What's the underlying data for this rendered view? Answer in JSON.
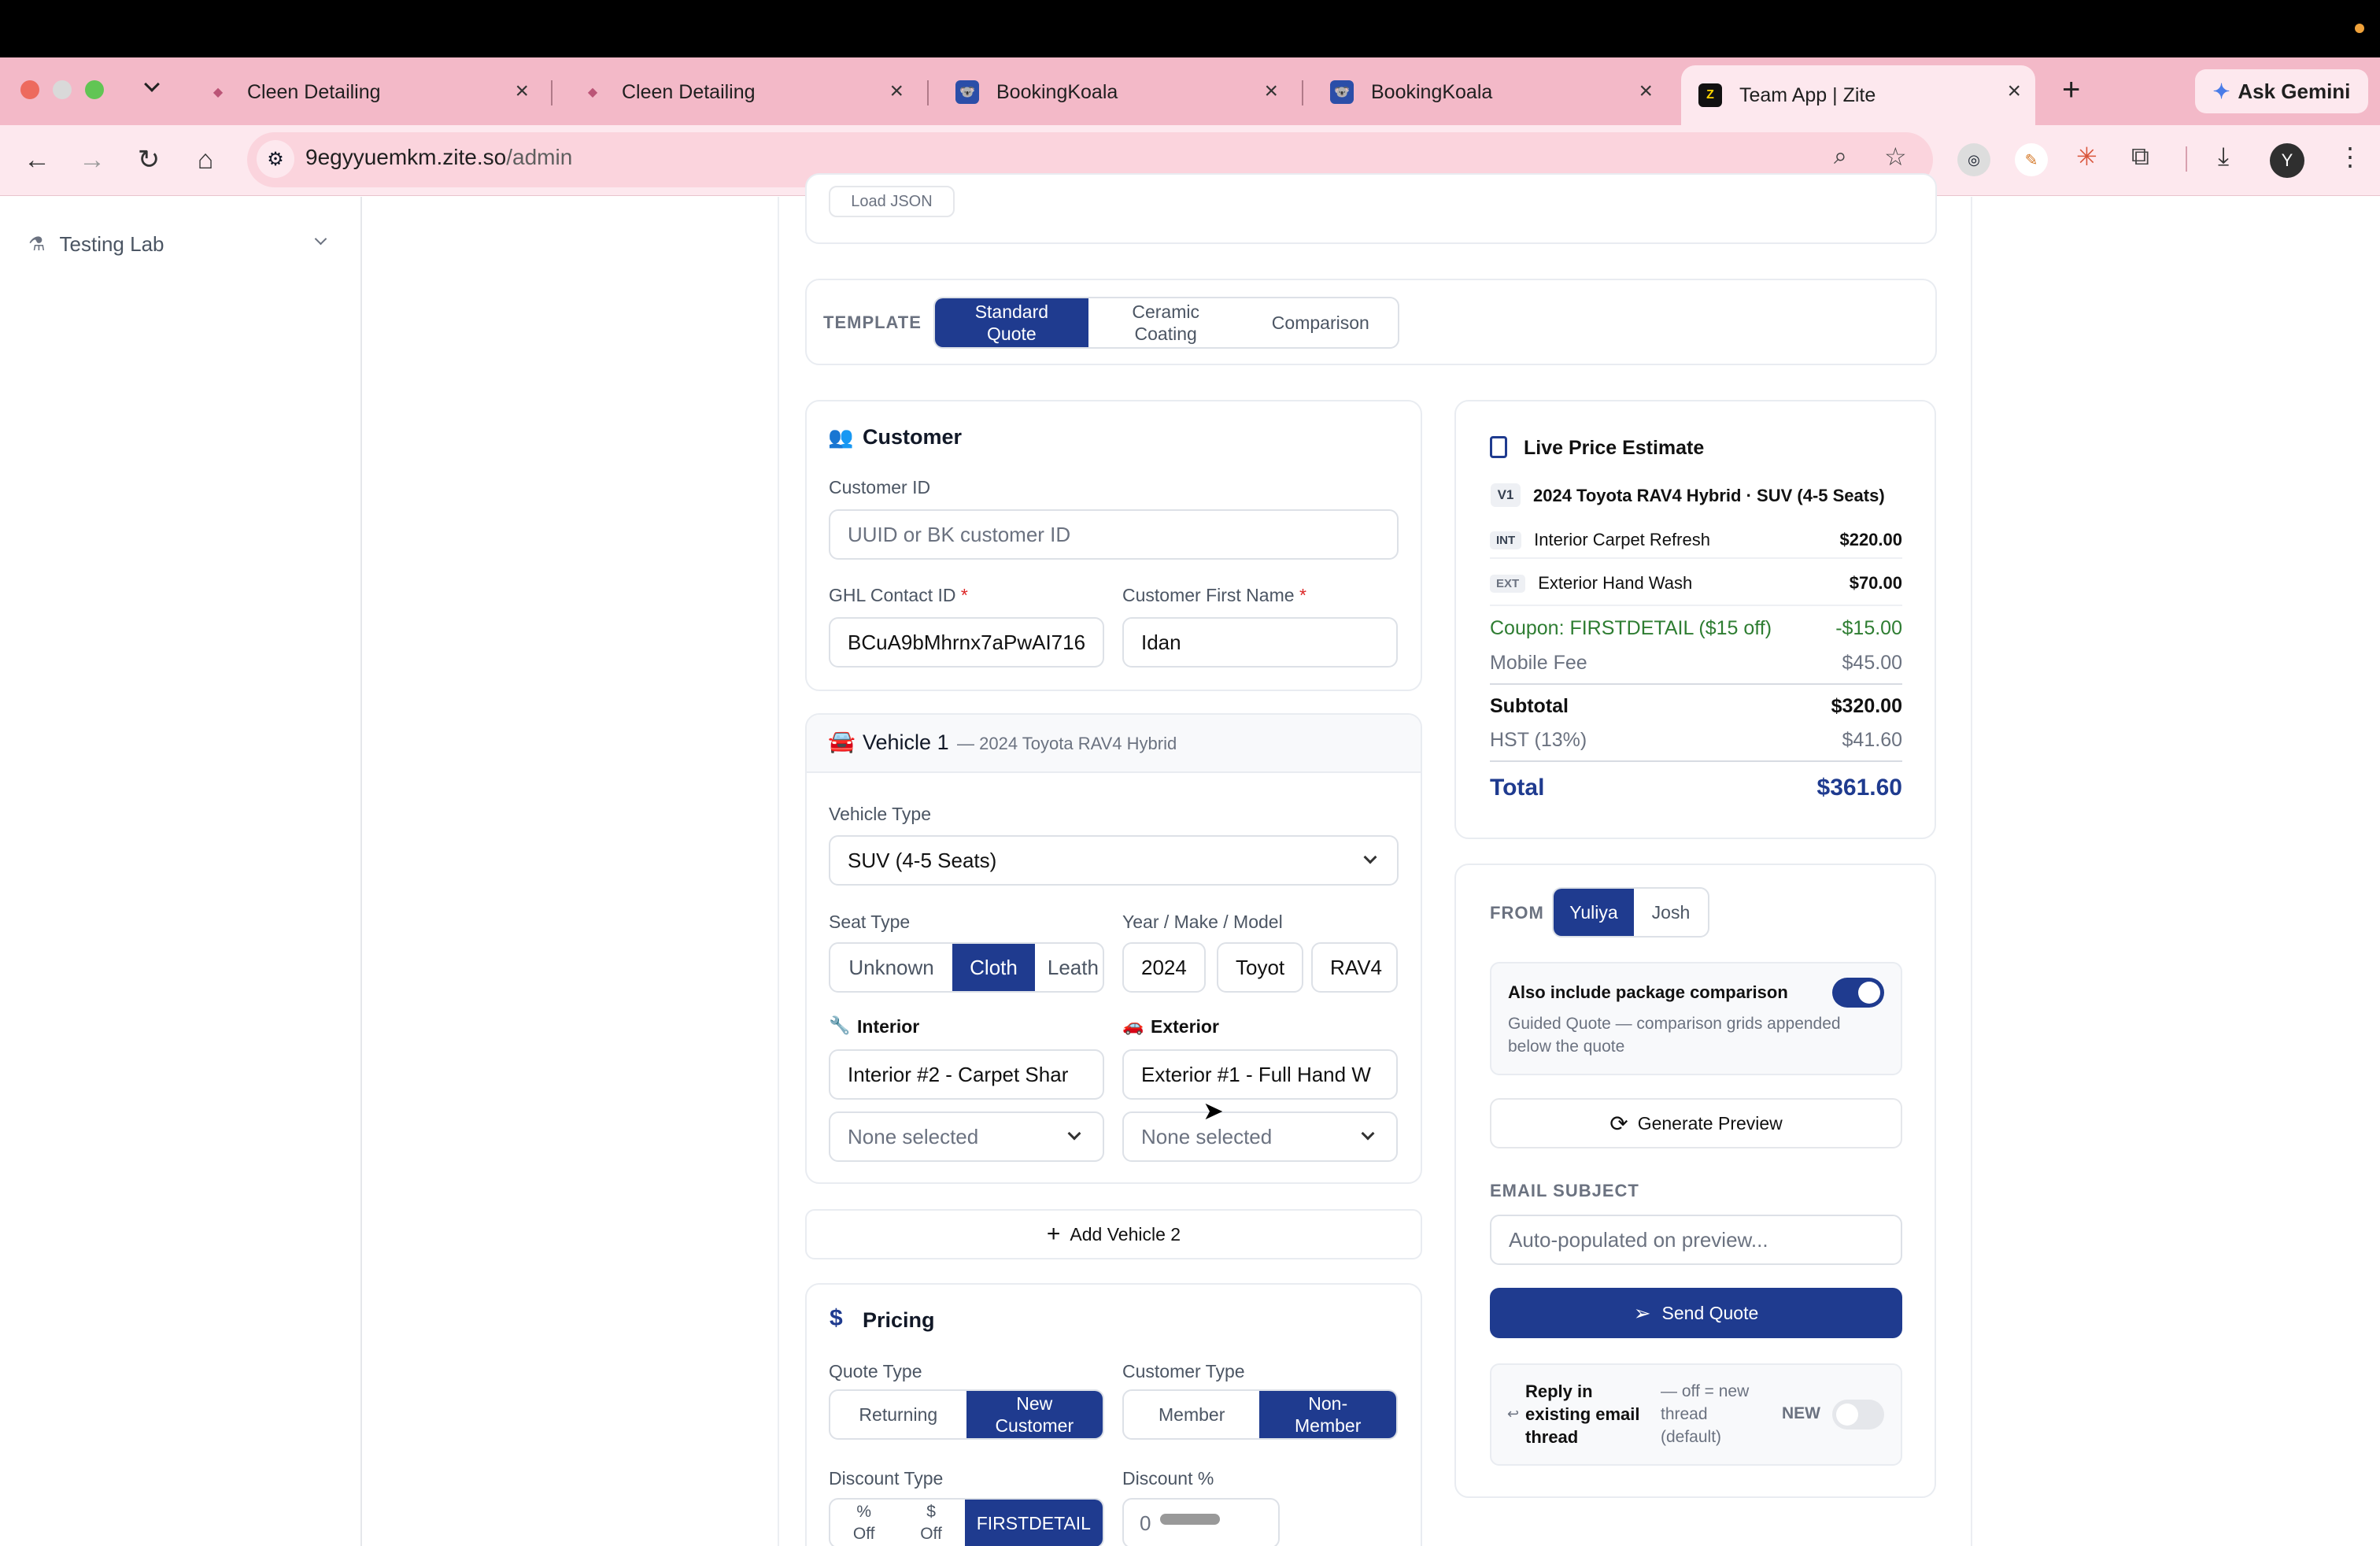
{
  "browser": {
    "tabs": [
      {
        "title": "Cleen Detailing"
      },
      {
        "title": "Cleen Detailing"
      },
      {
        "title": "BookingKoala"
      },
      {
        "title": "BookingKoala"
      },
      {
        "title": "Team App | Zite"
      }
    ],
    "new_tab": "+",
    "gemini": "Ask Gemini",
    "url_host": "9egyyuemkm.zite.so",
    "url_path": "/admin",
    "profile": "Y"
  },
  "sidebar": {
    "testing_lab": "Testing Lab"
  },
  "top": {
    "load_json": "Load JSON"
  },
  "template": {
    "label": "TEMPLATE",
    "options": [
      "Standard Quote",
      "Ceramic Coating",
      "Comparison"
    ],
    "selected": "Standard Quote"
  },
  "customer": {
    "title": "Customer",
    "customer_id_label": "Customer ID",
    "customer_id_placeholder": "UUID or BK customer ID",
    "ghl_label": "GHL Contact ID",
    "ghl_value": "BCuA9bMhrnx7aPwAI716",
    "first_name_label": "Customer First Name",
    "first_name_value": "Idan",
    "required": "*"
  },
  "vehicle": {
    "title": "Vehicle 1",
    "subtitle": "— 2024 Toyota RAV4 Hybrid",
    "type_label": "Vehicle Type",
    "type_value": "SUV (4-5 Seats)",
    "seat_label": "Seat Type",
    "seat_options": [
      "Unknown",
      "Cloth",
      "Leath"
    ],
    "seat_selected": "Cloth",
    "ymm_label": "Year / Make / Model",
    "year": "2024",
    "make": "Toyot",
    "model": "RAV4",
    "interior_label": "Interior",
    "interior_value": "Interior #2 - Carpet Shar",
    "interior_addon": "None selected",
    "exterior_label": "Exterior",
    "exterior_value": "Exterior #1 - Full Hand W",
    "exterior_addon": "None selected",
    "add_vehicle": "Add Vehicle 2"
  },
  "pricing": {
    "title": "Pricing",
    "quote_type_label": "Quote Type",
    "quote_type_options": [
      "Returning",
      "New Customer"
    ],
    "quote_type_selected": "New Customer",
    "customer_type_label": "Customer Type",
    "customer_type_options": [
      "Member",
      "Non-Member"
    ],
    "customer_type_selected": "Non-Member",
    "discount_type_label": "Discount Type",
    "discount_type_options": [
      "% Off",
      "$ Off",
      "FIRSTDETAIL"
    ],
    "discount_type_selected": "FIRSTDETAIL",
    "discount_pct_label": "Discount %",
    "discount_pct_value": "0"
  },
  "estimate": {
    "title": "Live Price Estimate",
    "vehicle_badge": "V1",
    "vehicle_line": "2024 Toyota RAV4 Hybrid · SUV (4-5 Seats)",
    "items": [
      {
        "tag": "INT",
        "name": "Interior Carpet Refresh",
        "price": "$220.00"
      },
      {
        "tag": "EXT",
        "name": "Exterior Hand Wash",
        "price": "$70.00"
      }
    ],
    "coupon_label": "Coupon: FIRSTDETAIL ($15 off)",
    "coupon_value": "-$15.00",
    "mobile_fee_label": "Mobile Fee",
    "mobile_fee_value": "$45.00",
    "subtotal_label": "Subtotal",
    "subtotal_value": "$320.00",
    "hst_label": "HST (13%)",
    "hst_value": "$41.60",
    "total_label": "Total",
    "total_value": "$361.60"
  },
  "send": {
    "from_label": "FROM",
    "from_options": [
      "Yuliya",
      "Josh"
    ],
    "from_selected": "Yuliya",
    "compare_title": "Also include package comparison",
    "compare_desc": "Guided Quote — comparison grids appended below the quote",
    "compare_on": true,
    "generate": "Generate Preview",
    "subject_label": "EMAIL SUBJECT",
    "subject_placeholder": "Auto-populated on preview...",
    "send_button": "Send Quote",
    "reply_title": "Reply in existing email thread",
    "reply_desc": "— off = new thread (default)",
    "reply_state": "NEW",
    "reply_on": false
  },
  "colors": {
    "navy": "#1f3b8f",
    "coupon_green": "#2e7d32",
    "tab_strip": "#f3b9c8"
  }
}
